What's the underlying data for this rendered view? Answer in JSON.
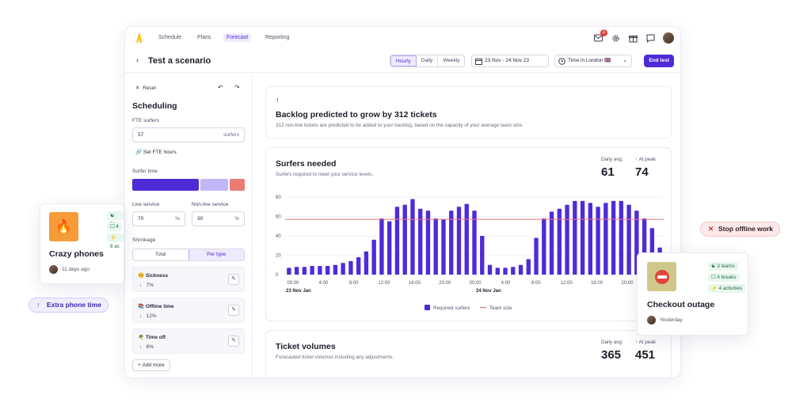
{
  "nav": {
    "items": [
      "Schedule",
      "Plans",
      "Forecast",
      "Reporting"
    ],
    "active": "Forecast",
    "notification_count": "2"
  },
  "header": {
    "title": "Test a scenario",
    "granularity": [
      "Hourly",
      "Daily",
      "Weekly"
    ],
    "granularity_selected": "Hourly",
    "date_range": "23 Nov - 24 Nov 23",
    "timezone": "Time in London 🇬🇧",
    "end_button": "End test"
  },
  "sidebar": {
    "reset": "Reset",
    "heading": "Scheduling",
    "fte_label": "FTE surfers",
    "fte_value": "57",
    "fte_suffix": "surfers",
    "set_fte": "Set FTE hours",
    "surfer_time": "Surfer time",
    "live_label": "Live service",
    "live_value": "70",
    "nonlive_label": "Non-live service",
    "nonlive_value": "30",
    "percent": "%",
    "shrinkage": "Shrinkage",
    "toggle": [
      "Total",
      "Per type"
    ],
    "items": [
      {
        "name": "🤒 Sickness",
        "value": "7%"
      },
      {
        "name": "📚 Offline time",
        "value": "12%"
      },
      {
        "name": "🌴 Time off",
        "value": "8%"
      }
    ],
    "add_more": "Add more"
  },
  "backlog": {
    "title": "Backlog predicted to grow by 312 tickets",
    "subtitle": "312 non-live tickets are predicted to be added to your backlog, based on the capacity of your average team size."
  },
  "surfers": {
    "title": "Surfers needed",
    "subtitle": "Surfers required to meet your service levels.",
    "daily_label": "Daily avg.",
    "daily_value": "61",
    "peak_label": "At peak",
    "peak_value": "74"
  },
  "chart_data": {
    "type": "bar",
    "ylim": [
      0,
      80
    ],
    "yticks": [
      "0",
      "20",
      "40",
      "60",
      "80"
    ],
    "xticks": [
      "00:00",
      "4:00",
      "8:00",
      "12:00",
      "16:00",
      "20:00",
      "00:00",
      "4:00",
      "8:00",
      "12:00",
      "16:00",
      "20:00",
      "00:00"
    ],
    "date_labels": [
      "23 Nov Jan",
      "24 Nov Jan"
    ],
    "series": [
      {
        "name": "Required surfers",
        "color": "#4f2bd8",
        "values": [
          7,
          8,
          8,
          9,
          9,
          9,
          10,
          12,
          14,
          18,
          24,
          36,
          58,
          55,
          70,
          72,
          78,
          68,
          66,
          58,
          57,
          66,
          70,
          73,
          66,
          40,
          10,
          7,
          7,
          8,
          10,
          16,
          38,
          58,
          65,
          68,
          72,
          76,
          76,
          74,
          70,
          74,
          76,
          76,
          72,
          66,
          58,
          48,
          28
        ]
      },
      {
        "name": "Team size",
        "color": "#e0777a",
        "values": [
          57
        ]
      }
    ],
    "legend": [
      "Required surfers",
      "Team size"
    ]
  },
  "tickets": {
    "title": "Ticket volumes",
    "subtitle": "Forecasted ticket volumes including any adjustments.",
    "daily_label": "Daily avg.",
    "daily_value": "365",
    "peak_label": "At peak",
    "peak_value": "451"
  },
  "float_left": {
    "title": "Crazy phones",
    "meta": "11 days ago",
    "chips": [
      "53",
      "4",
      "8 ac"
    ]
  },
  "float_right": {
    "title": "Checkout outage",
    "meta": "Yesterday",
    "chips": [
      "3 teams",
      "4 breaks",
      "4 activities"
    ]
  },
  "pill_left": "Extra phone time",
  "pill_right": "Stop offline work"
}
